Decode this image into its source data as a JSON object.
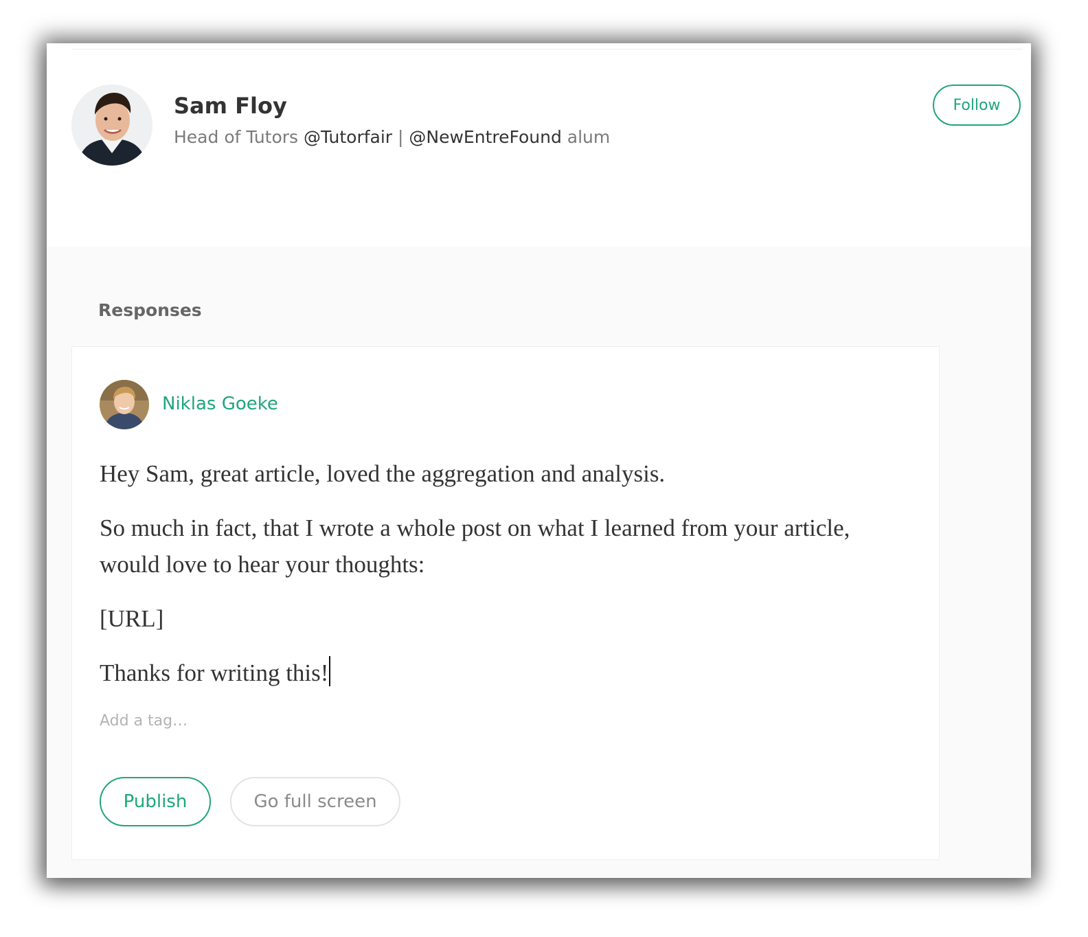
{
  "author": {
    "name": "Sam Floy",
    "bio_prefix": "Head of Tutors ",
    "bio_mention_1": "@Tutorfair",
    "bio_separator": " | ",
    "bio_mention_2": "@NewEntreFound",
    "bio_suffix": " alum",
    "avatar_icon": "person-photo-avatar"
  },
  "follow": {
    "label": "Follow"
  },
  "responses": {
    "heading": "Responses"
  },
  "response": {
    "author_name": "Niklas Goeke",
    "avatar_icon": "person-photo-avatar",
    "paragraphs": [
      "Hey Sam, great article, loved the aggregation and analysis.",
      "So much in fact, that I wrote a whole post on what I learned from your article, would love to hear your thoughts:",
      "[URL]",
      "Thanks for writing this!"
    ],
    "tag_placeholder": "Add a tag…",
    "publish_label": "Publish",
    "fullscreen_label": "Go full screen"
  },
  "colors": {
    "accent": "#1fa57c",
    "text": "#333333",
    "muted": "#7a7a7a",
    "section_bg": "#fafafa"
  }
}
